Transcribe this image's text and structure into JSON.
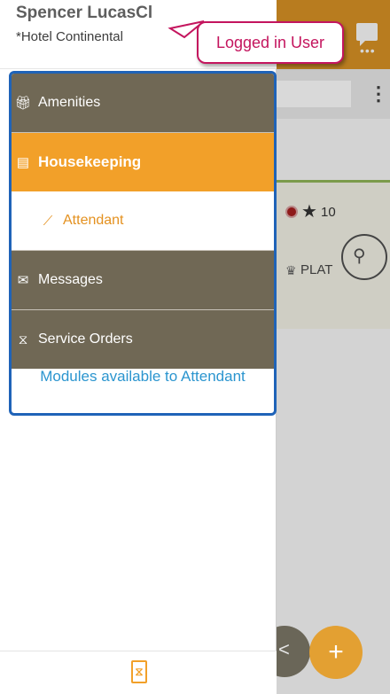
{
  "app": {
    "card": {
      "rating": "10",
      "tier": "PLAT"
    },
    "fab": {
      "add_symbol": "+",
      "close_symbol": "<"
    }
  },
  "drawer": {
    "user_name": "Spencer LucasCl",
    "hotel": "*Hotel Continental",
    "menu": [
      {
        "label": "Amenities",
        "icon": "gift-icon",
        "state": "default"
      },
      {
        "label": "Housekeeping",
        "icon": "clipboard-icon",
        "state": "active"
      },
      {
        "label": "Attendant",
        "icon": "broom-icon",
        "state": "sub-item"
      },
      {
        "label": "Messages",
        "icon": "envelope-icon",
        "state": "default"
      },
      {
        "label": "Service Orders",
        "icon": "hourglass-icon",
        "state": "default"
      }
    ],
    "modules_note": "Modules available to Attendant",
    "footer_icon": "clipboard-hourglass-icon"
  },
  "callout": {
    "text": "Logged in User"
  },
  "colors": {
    "menu_dark": "#706855",
    "menu_active": "#f2a029",
    "sub_item_text": "#e4911f",
    "highlight_border": "#1f63b8",
    "callout": "#c4155e",
    "note_text": "#2b95cf",
    "app_header": "#b87c1f"
  }
}
